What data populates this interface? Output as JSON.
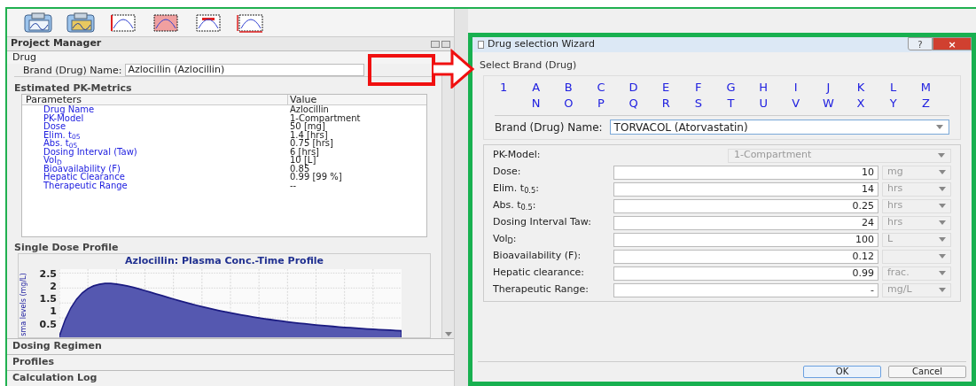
{
  "left_panel": {
    "title": "Project Manager",
    "drug_tab": {
      "title": "Drug",
      "brand_label": "Brand (Drug) Name:",
      "brand_value": "Azlocillin (Azlocillin)"
    },
    "metrics": {
      "title": "Estimated PK-Metrics",
      "columns": [
        "Parameters",
        "Value"
      ],
      "rows": [
        {
          "parameter": "Drug Name",
          "value": "Azlocillin"
        },
        {
          "parameter": "PK-Model",
          "value": "1-Compartment"
        },
        {
          "parameter": "Dose",
          "value": "50 [mg]"
        },
        {
          "parameter": "Elim. t$_{05}$",
          "value": "1.4 [hrs]"
        },
        {
          "parameter": "Abs. t$_{05}$",
          "value": "0.75 [hrs]"
        },
        {
          "parameter": "Dosing Interval (Taw)",
          "value": "6 [hrs]"
        },
        {
          "parameter": "Vol$_{D}$",
          "value": "10 [L]"
        },
        {
          "parameter": "Bioavailability (F)",
          "value": "0.85"
        },
        {
          "parameter": "Hepatic Clearance",
          "value": "0.99 [99 %]"
        },
        {
          "parameter": "Therapeutic Range",
          "value": "--"
        }
      ]
    },
    "profile": {
      "title": "Single Dose Profile",
      "chart_title": "Azlocillin: Plasma Conc.-Time Profile",
      "ylabel": "sma levels (mg/L)",
      "yticks": [
        "2.5",
        "2",
        "1.5",
        "1",
        "0.5"
      ]
    },
    "sections": [
      "Dosing Regimen",
      "Profiles",
      "Calculation Log"
    ]
  },
  "dialog": {
    "title": "Drug selection Wizard",
    "help": "?",
    "close": "×",
    "group_title": "Select Brand (Drug)",
    "letters_row_1": [
      "1",
      "A",
      "B",
      "C",
      "D",
      "E",
      "F",
      "G",
      "H",
      "I",
      "J",
      "K",
      "L",
      "M"
    ],
    "letters_row_2": [
      "N",
      "O",
      "P",
      "Q",
      "R",
      "S",
      "T",
      "U",
      "V",
      "W",
      "X",
      "Y",
      "Z"
    ],
    "brand_label": "Brand (Drug) Name:",
    "brand_value": "TORVACOL (Atorvastatin)",
    "pk_model": {
      "label": "PK-Model:",
      "value": "1-Compartment"
    },
    "fields": [
      {
        "label": "Dose:",
        "value": "10",
        "unit": "mg"
      },
      {
        "label": "Elim. t$_{0.5}$:",
        "value": "14",
        "unit": "hrs"
      },
      {
        "label": "Abs. t$_{0.5}$:",
        "value": "0.25",
        "unit": "hrs"
      },
      {
        "label": "Dosing Interval Taw:",
        "value": "24",
        "unit": "hrs"
      },
      {
        "label": "Vol$_{D}$:",
        "value": "100",
        "unit": "L"
      },
      {
        "label": "Bioavailability (F):",
        "value": "0.12"
      },
      {
        "label": "Hepatic clearance:",
        "value": "0.99",
        "unit": "frac."
      },
      {
        "label": "Therapeutic Range:",
        "value": "-",
        "unit": "mg/L"
      }
    ],
    "buttons": [
      "OK",
      "Cancel"
    ]
  }
}
